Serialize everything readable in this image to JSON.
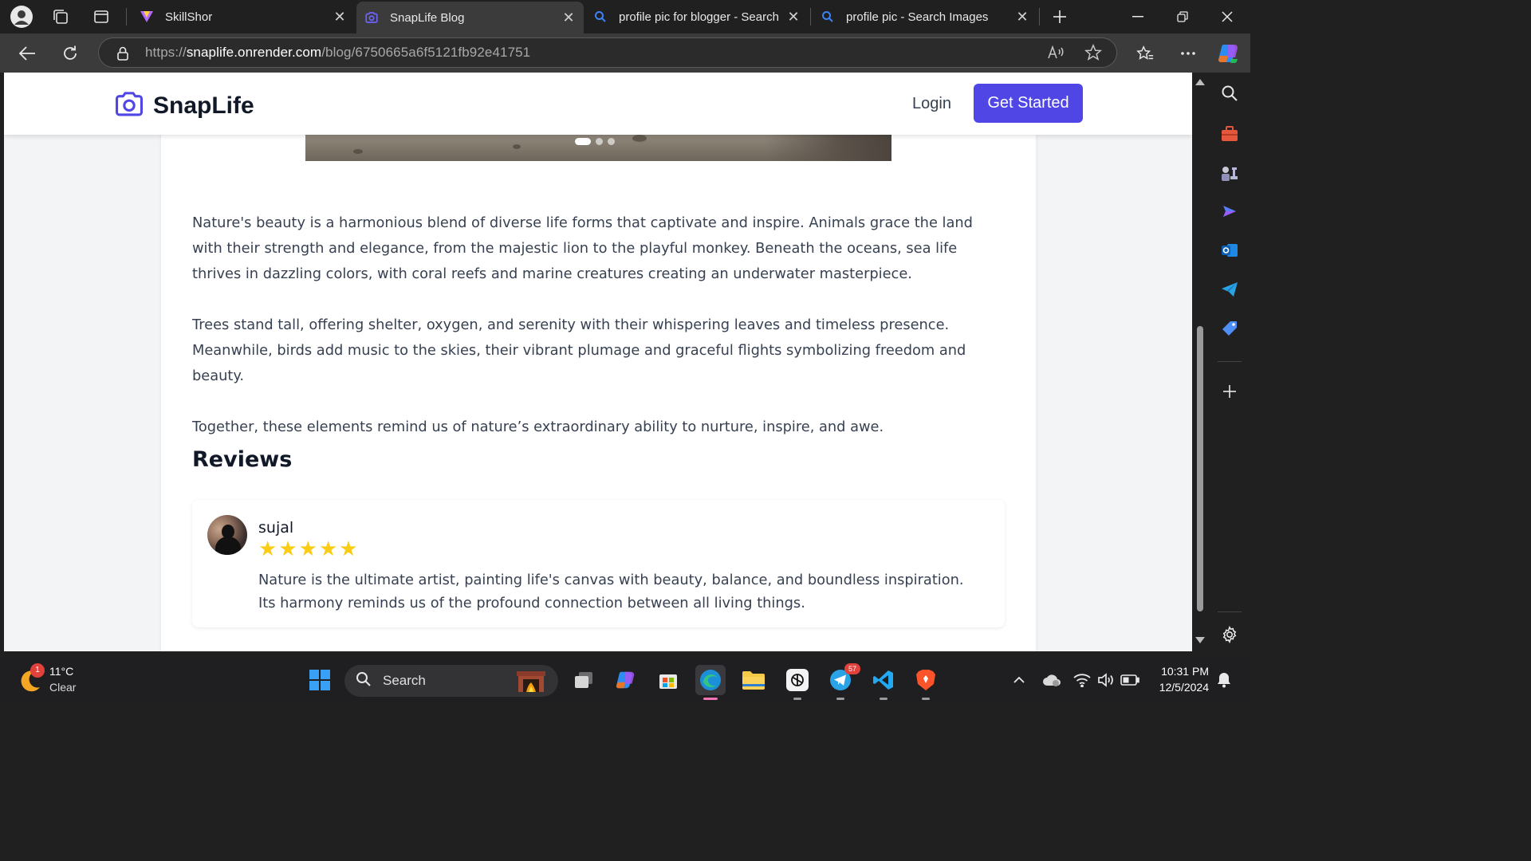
{
  "browser": {
    "tabs": [
      {
        "title": "SkillShor",
        "active": false
      },
      {
        "title": "SnapLife Blog",
        "active": true
      },
      {
        "title": "profile pic for blogger - Search",
        "active": false
      },
      {
        "title": "profile pic - Search Images",
        "active": false
      }
    ],
    "url": {
      "scheme": "https://",
      "host": "snaplife.onrender.com",
      "path": "/blog/6750665a6f5121fb92e41751"
    }
  },
  "site": {
    "brand": "SnapLife",
    "nav": {
      "login": "Login",
      "cta": "Get Started"
    },
    "accent": "#4f46e5",
    "carousel": {
      "slides": 3,
      "active": 1
    }
  },
  "article": {
    "paragraphs": [
      "Nature's beauty is a harmonious blend of diverse life forms that captivate and inspire. Animals grace the land with their strength and elegance, from the majestic lion to the playful monkey. Beneath the oceans, sea life thrives in dazzling colors, with coral reefs and marine creatures creating an underwater masterpiece.",
      "Trees stand tall, offering shelter, oxygen, and serenity with their whispering leaves and timeless presence. Meanwhile, birds add music to the skies, their vibrant plumage and graceful flights symbolizing freedom and beauty.",
      "Together, these elements remind us of nature’s extraordinary ability to nurture, inspire, and awe."
    ]
  },
  "reviews": {
    "heading": "Reviews",
    "items": [
      {
        "name": "sujal",
        "rating": 5,
        "text": "Nature is the ultimate artist, painting life's canvas with beauty, balance, and boundless inspiration. Its harmony reminds us of the profound connection between all living things."
      }
    ],
    "star_color": "#facc15"
  },
  "taskbar": {
    "weather": {
      "temp": "11°C",
      "condition": "Clear",
      "badge": "1"
    },
    "search_label": "Search",
    "telegram_badge": "57",
    "time": "10:31 PM",
    "date": "12/5/2024"
  }
}
